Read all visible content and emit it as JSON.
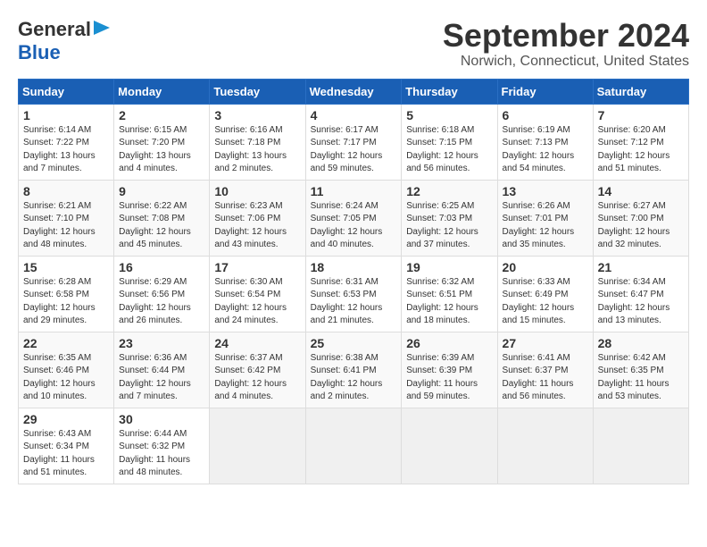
{
  "logo": {
    "line1": "General",
    "line2": "Blue"
  },
  "title": "September 2024",
  "subtitle": "Norwich, Connecticut, United States",
  "days_of_week": [
    "Sunday",
    "Monday",
    "Tuesday",
    "Wednesday",
    "Thursday",
    "Friday",
    "Saturday"
  ],
  "weeks": [
    [
      {
        "day": "1",
        "info": "Sunrise: 6:14 AM\nSunset: 7:22 PM\nDaylight: 13 hours\nand 7 minutes."
      },
      {
        "day": "2",
        "info": "Sunrise: 6:15 AM\nSunset: 7:20 PM\nDaylight: 13 hours\nand 4 minutes."
      },
      {
        "day": "3",
        "info": "Sunrise: 6:16 AM\nSunset: 7:18 PM\nDaylight: 13 hours\nand 2 minutes."
      },
      {
        "day": "4",
        "info": "Sunrise: 6:17 AM\nSunset: 7:17 PM\nDaylight: 12 hours\nand 59 minutes."
      },
      {
        "day": "5",
        "info": "Sunrise: 6:18 AM\nSunset: 7:15 PM\nDaylight: 12 hours\nand 56 minutes."
      },
      {
        "day": "6",
        "info": "Sunrise: 6:19 AM\nSunset: 7:13 PM\nDaylight: 12 hours\nand 54 minutes."
      },
      {
        "day": "7",
        "info": "Sunrise: 6:20 AM\nSunset: 7:12 PM\nDaylight: 12 hours\nand 51 minutes."
      }
    ],
    [
      {
        "day": "8",
        "info": "Sunrise: 6:21 AM\nSunset: 7:10 PM\nDaylight: 12 hours\nand 48 minutes."
      },
      {
        "day": "9",
        "info": "Sunrise: 6:22 AM\nSunset: 7:08 PM\nDaylight: 12 hours\nand 45 minutes."
      },
      {
        "day": "10",
        "info": "Sunrise: 6:23 AM\nSunset: 7:06 PM\nDaylight: 12 hours\nand 43 minutes."
      },
      {
        "day": "11",
        "info": "Sunrise: 6:24 AM\nSunset: 7:05 PM\nDaylight: 12 hours\nand 40 minutes."
      },
      {
        "day": "12",
        "info": "Sunrise: 6:25 AM\nSunset: 7:03 PM\nDaylight: 12 hours\nand 37 minutes."
      },
      {
        "day": "13",
        "info": "Sunrise: 6:26 AM\nSunset: 7:01 PM\nDaylight: 12 hours\nand 35 minutes."
      },
      {
        "day": "14",
        "info": "Sunrise: 6:27 AM\nSunset: 7:00 PM\nDaylight: 12 hours\nand 32 minutes."
      }
    ],
    [
      {
        "day": "15",
        "info": "Sunrise: 6:28 AM\nSunset: 6:58 PM\nDaylight: 12 hours\nand 29 minutes."
      },
      {
        "day": "16",
        "info": "Sunrise: 6:29 AM\nSunset: 6:56 PM\nDaylight: 12 hours\nand 26 minutes."
      },
      {
        "day": "17",
        "info": "Sunrise: 6:30 AM\nSunset: 6:54 PM\nDaylight: 12 hours\nand 24 minutes."
      },
      {
        "day": "18",
        "info": "Sunrise: 6:31 AM\nSunset: 6:53 PM\nDaylight: 12 hours\nand 21 minutes."
      },
      {
        "day": "19",
        "info": "Sunrise: 6:32 AM\nSunset: 6:51 PM\nDaylight: 12 hours\nand 18 minutes."
      },
      {
        "day": "20",
        "info": "Sunrise: 6:33 AM\nSunset: 6:49 PM\nDaylight: 12 hours\nand 15 minutes."
      },
      {
        "day": "21",
        "info": "Sunrise: 6:34 AM\nSunset: 6:47 PM\nDaylight: 12 hours\nand 13 minutes."
      }
    ],
    [
      {
        "day": "22",
        "info": "Sunrise: 6:35 AM\nSunset: 6:46 PM\nDaylight: 12 hours\nand 10 minutes."
      },
      {
        "day": "23",
        "info": "Sunrise: 6:36 AM\nSunset: 6:44 PM\nDaylight: 12 hours\nand 7 minutes."
      },
      {
        "day": "24",
        "info": "Sunrise: 6:37 AM\nSunset: 6:42 PM\nDaylight: 12 hours\nand 4 minutes."
      },
      {
        "day": "25",
        "info": "Sunrise: 6:38 AM\nSunset: 6:41 PM\nDaylight: 12 hours\nand 2 minutes."
      },
      {
        "day": "26",
        "info": "Sunrise: 6:39 AM\nSunset: 6:39 PM\nDaylight: 11 hours\nand 59 minutes."
      },
      {
        "day": "27",
        "info": "Sunrise: 6:41 AM\nSunset: 6:37 PM\nDaylight: 11 hours\nand 56 minutes."
      },
      {
        "day": "28",
        "info": "Sunrise: 6:42 AM\nSunset: 6:35 PM\nDaylight: 11 hours\nand 53 minutes."
      }
    ],
    [
      {
        "day": "29",
        "info": "Sunrise: 6:43 AM\nSunset: 6:34 PM\nDaylight: 11 hours\nand 51 minutes."
      },
      {
        "day": "30",
        "info": "Sunrise: 6:44 AM\nSunset: 6:32 PM\nDaylight: 11 hours\nand 48 minutes."
      },
      null,
      null,
      null,
      null,
      null
    ]
  ]
}
